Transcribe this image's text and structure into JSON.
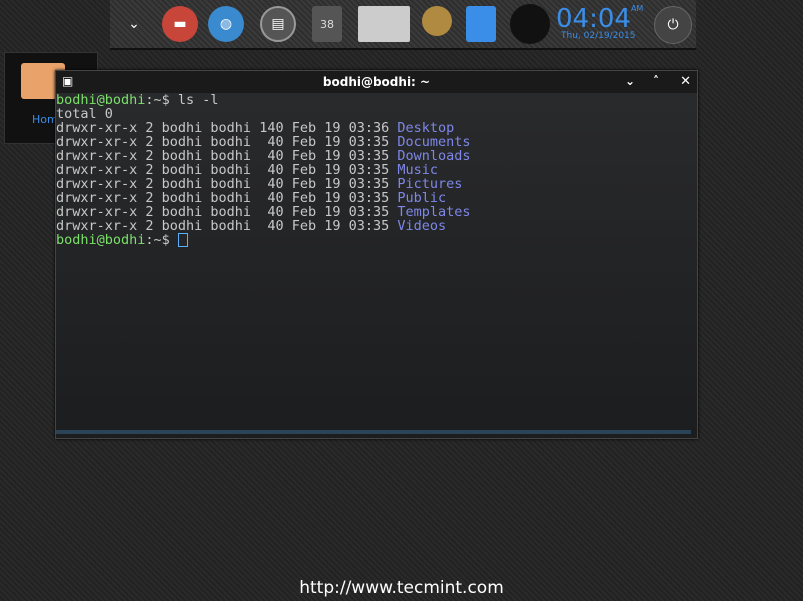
{
  "dock": {
    "clock_time": "04:04",
    "clock_ampm": "AM",
    "clock_date": "Thu, 02/19/2015",
    "calendar_day": "38"
  },
  "desktop": {
    "home_label": "Home"
  },
  "terminal": {
    "title": "bodhi@bodhi: ~",
    "prompt_user": "bodhi@bodhi",
    "prompt_path": ":~$ ",
    "command": "ls -l",
    "total": "total 0",
    "rows": [
      {
        "meta": "drwxr-xr-x 2 bodhi bodhi 140 Feb 19 03:36 ",
        "name": "Desktop"
      },
      {
        "meta": "drwxr-xr-x 2 bodhi bodhi  40 Feb 19 03:35 ",
        "name": "Documents"
      },
      {
        "meta": "drwxr-xr-x 2 bodhi bodhi  40 Feb 19 03:35 ",
        "name": "Downloads"
      },
      {
        "meta": "drwxr-xr-x 2 bodhi bodhi  40 Feb 19 03:35 ",
        "name": "Music"
      },
      {
        "meta": "drwxr-xr-x 2 bodhi bodhi  40 Feb 19 03:35 ",
        "name": "Pictures"
      },
      {
        "meta": "drwxr-xr-x 2 bodhi bodhi  40 Feb 19 03:35 ",
        "name": "Public"
      },
      {
        "meta": "drwxr-xr-x 2 bodhi bodhi  40 Feb 19 03:35 ",
        "name": "Templates"
      },
      {
        "meta": "drwxr-xr-x 2 bodhi bodhi  40 Feb 19 03:35 ",
        "name": "Videos"
      }
    ]
  },
  "watermark": "http://www.tecmint.com"
}
